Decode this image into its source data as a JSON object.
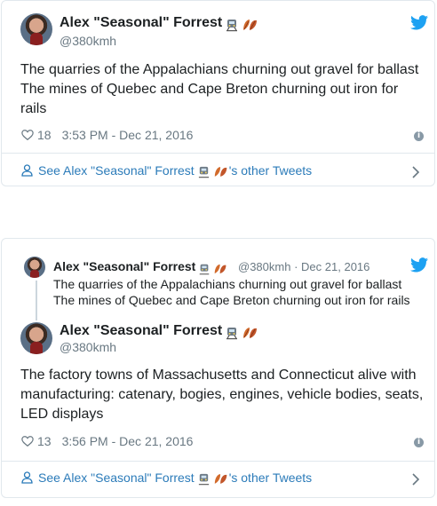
{
  "tweet1": {
    "author_name": "Alex \"Seasonal\" Forrest",
    "author_handle": "@380kmh",
    "text_lines": [
      "The quarries of the Appalachians churning out gravel for ballast",
      "The mines of Quebec and Cape Breton churning out iron for",
      "rails"
    ],
    "like_count": "18",
    "timestamp": "3:53 PM - Dec 21, 2016",
    "see_more_prefix": "See Alex \"Seasonal\" Forrest",
    "see_more_suffix": "'s other Tweets"
  },
  "tweet2": {
    "quoted": {
      "author_name": "Alex \"Seasonal\" Forrest",
      "author_handle": "@380kmh",
      "date": "Dec 21, 2016",
      "text_lines": [
        "The quarries of the Appalachians churning out gravel for ballast",
        "The mines of Quebec and Cape Breton churning out iron for rails"
      ]
    },
    "author_name": "Alex \"Seasonal\" Forrest",
    "author_handle": "@380kmh",
    "text_lines": [
      "The factory towns of Massachusetts and Connecticut alive with",
      "manufacturing: catenary, bogies, engines, vehicle bodies, seats,",
      "LED displays"
    ],
    "like_count": "13",
    "timestamp": "3:56 PM - Dec 21, 2016",
    "see_more_prefix": "See Alex \"Seasonal\" Forrest",
    "see_more_suffix": "'s other Tweets"
  },
  "separator": "·",
  "icons": {
    "bird": "twitter-bird-icon",
    "heart": "heart-icon",
    "info": "info-icon",
    "person": "person-icon",
    "chevron": "chevron-right-icon",
    "emoji_train": "train-emoji-icon",
    "emoji_leaves": "leaves-emoji-icon"
  },
  "colors": {
    "bird": "#1da1f2",
    "link": "#2b7bb9",
    "muted": "#697882",
    "text": "#1c2022",
    "border": "#e1e8ed"
  }
}
